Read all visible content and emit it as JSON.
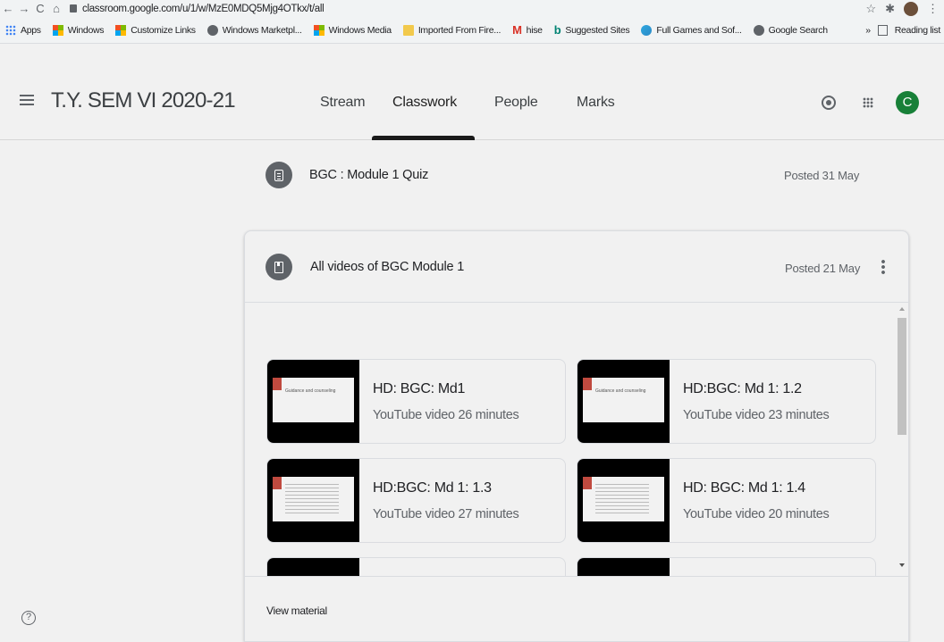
{
  "browser": {
    "url": "classroom.google.com/u/1/w/MzE0MDQ5Mjg4OTkx/t/all",
    "nav": [
      "←",
      "→",
      "C",
      "⌂"
    ],
    "right_icons": [
      "☆",
      "✱"
    ]
  },
  "bookmarks": {
    "items": [
      {
        "label": "Apps",
        "icon": "apps-icon"
      },
      {
        "label": "Windows",
        "icon": "windows-icon"
      },
      {
        "label": "Customize Links",
        "icon": "windows-icon"
      },
      {
        "label": "Windows Marketpl...",
        "icon": "globe-icon"
      },
      {
        "label": "Windows Media",
        "icon": "windows-icon"
      },
      {
        "label": "Imported From Fire...",
        "icon": "folder-icon"
      },
      {
        "label": "hise",
        "icon": "gmail-icon"
      },
      {
        "label": "Suggested Sites",
        "icon": "bing-icon"
      },
      {
        "label": "Full Games and Sof...",
        "icon": "edge-icon"
      },
      {
        "label": "Google Search",
        "icon": "globe-icon"
      }
    ],
    "overflow": "»",
    "reading_list": "Reading list"
  },
  "header": {
    "class_title": "T.Y. SEM VI 2020-21",
    "tabs": [
      "Stream",
      "Classwork",
      "People",
      "Marks"
    ],
    "active_tab": "Classwork",
    "avatar_letter": "C"
  },
  "items": [
    {
      "title": "BGC : Module 1 Quiz",
      "posted": "Posted 31 May",
      "icon": "assignment-icon"
    },
    {
      "title": "All videos of BGC Module 1",
      "posted": "Posted 21 May",
      "icon": "material-icon"
    }
  ],
  "videos": [
    {
      "title": "HD: BGC: Md1",
      "meta": "YouTube video  26 minutes",
      "slide": "Guidance and counseling"
    },
    {
      "title": "HD:BGC: Md 1: 1.2",
      "meta": "YouTube video  23 minutes",
      "slide": "Guidance and counseling"
    },
    {
      "title": "HD:BGC: Md 1: 1.3",
      "meta": "YouTube video  27 minutes",
      "slide": ""
    },
    {
      "title": "HD: BGC: Md 1: 1.4",
      "meta": "YouTube video  20 minutes",
      "slide": ""
    }
  ],
  "footer": {
    "view_material": "View material"
  }
}
